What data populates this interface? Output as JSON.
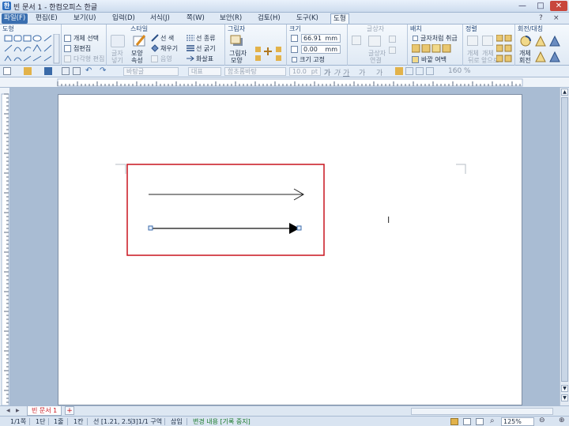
{
  "window": {
    "title": "빈 문서 1 - 한컴오피스 한글",
    "icon_glyph": "한",
    "buttons": {
      "minimize": "—",
      "maximize": "□",
      "close": "✕"
    }
  },
  "menu": {
    "file": "파일(F)",
    "items": [
      "편집(E)",
      "보기(U)",
      "입력(D)",
      "서식(J)",
      "쪽(W)",
      "보안(R)",
      "검토(H)",
      "도구(K)"
    ],
    "active_tab": "도형",
    "help": [
      "?",
      "×"
    ]
  },
  "ribbon": {
    "shape": {
      "title": "도형",
      "object_select": "개체 선택",
      "points": "점편집",
      "polygon_edit": "다각형 편집"
    },
    "style": {
      "title": "스타일",
      "text_box": "글자",
      "text_box2": "넣기",
      "shape_attr": "모양",
      "shape_attr2": "속성",
      "line_color": "선 색",
      "fill": "채우기",
      "effect": "음영",
      "line_type": "선 종류",
      "line_width": "선 굵기",
      "arrow": "화살표"
    },
    "shadow": {
      "title": "그림자",
      "shape_label": "그림자",
      "shape_label2": "모양"
    },
    "size": {
      "title": "크기",
      "width_value": "66.91",
      "height_value": "0.00",
      "unit": "mm",
      "fix_size": "크기 고정"
    },
    "glow": {
      "title": "글상자",
      "label1": "글상자",
      "label2": "연결"
    },
    "layout": {
      "title": "배치",
      "text_wrap": "글자처럼 취급",
      "margin": "바깥 여백"
    },
    "align": {
      "title": "정렬",
      "send": "개체",
      "send2": "뒤로",
      "bring": "개체",
      "bring2": "앞으로"
    },
    "rotate": {
      "title": "회전/대칭",
      "label": "개체",
      "label2": "회전"
    }
  },
  "toolbar2": {
    "style_field": "바탕글",
    "lang_field": "대표",
    "font_field": "함초롬바탕",
    "size_value": "10.0",
    "size_unit": "pt",
    "bold": "가",
    "italic": "가",
    "underline": "가",
    "color": "가",
    "highlight": "가",
    "linespacing": "160 %"
  },
  "document": {
    "cursor_glyph": "I"
  },
  "tabs": {
    "doc_tab": "빈 문서 1",
    "add_tab": "+"
  },
  "status": {
    "pages": "1/1쪽",
    "section": "1단",
    "line": "1줄",
    "column": "1칸",
    "position": "선 [1.21, 2.53]",
    "area": "1/1 구역",
    "mode": "삽입",
    "track": "변경 내용 [기록 중지]",
    "zoom": "125%",
    "accent_color": "#1a7a2a"
  }
}
